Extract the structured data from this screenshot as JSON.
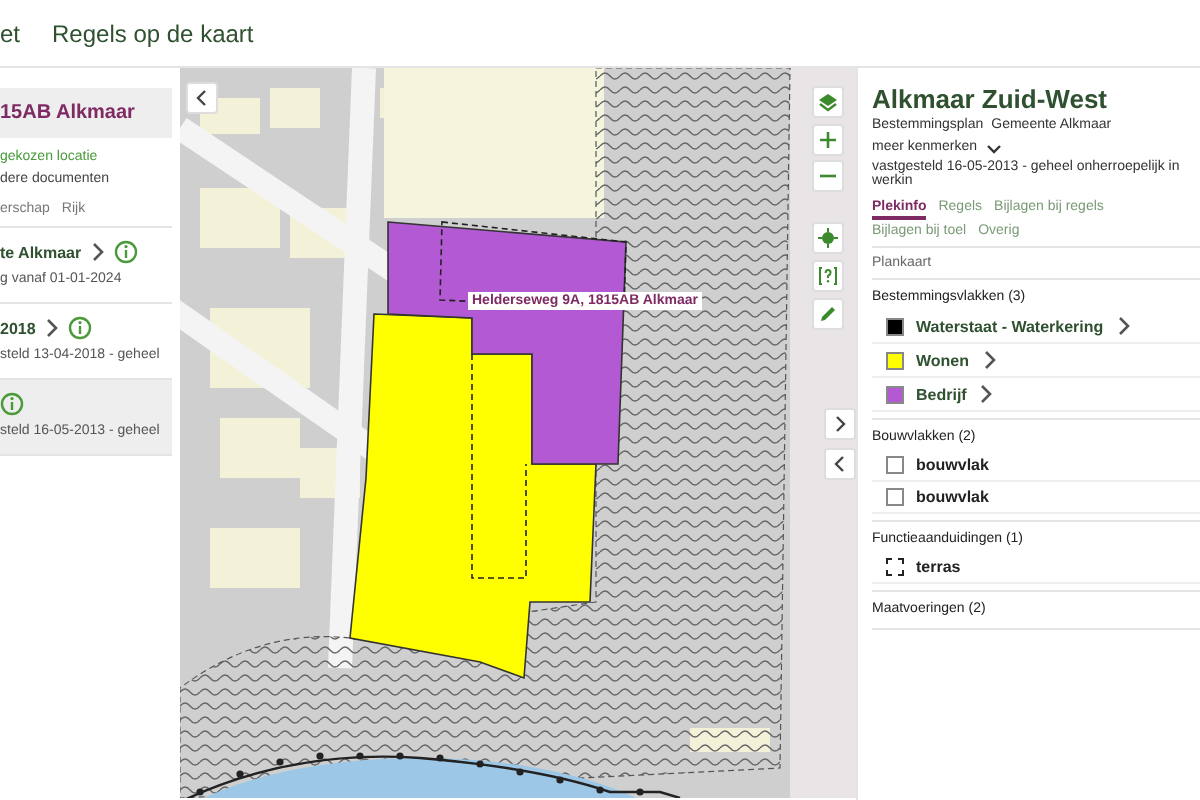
{
  "header": {
    "nav": [
      {
        "label": "et"
      },
      {
        "label": "Regels op de kaart"
      }
    ]
  },
  "left_panel": {
    "address": "15AB Alkmaar",
    "location_link": "gekozen locatie",
    "documents_text": "dere documenten",
    "tabs": [
      {
        "label": "erschap",
        "selected": false
      },
      {
        "label": "Rijk",
        "selected": false
      }
    ],
    "plans": [
      {
        "title": "te Alkmaar",
        "expandable": true,
        "status": "g vanaf 01-01-2024",
        "selected": false
      },
      {
        "title": "2018",
        "expandable": true,
        "status": "steld 13-04-2018 - geheel",
        "selected": false
      },
      {
        "expandable": false,
        "status": "steld 16-05-2013 - geheel",
        "selected": true
      }
    ]
  },
  "map": {
    "address_label": "Helderseweg 9A, 1815AB Alkmaar"
  },
  "right_panel": {
    "title": "Alkmaar Zuid-West",
    "subtitle": [
      "Bestemmingsplan",
      "Gemeente Alkmaar"
    ],
    "more_link": "meer kenmerken",
    "status": "vastgesteld 16-05-2013 - geheel onherroepelijk in werkin",
    "tabs": [
      {
        "label": "Plekinfo",
        "selected": true
      },
      {
        "label": "Regels",
        "selected": false
      },
      {
        "label": "Bijlagen bij regels",
        "selected": false
      },
      {
        "label": "Bijlagen bij toel",
        "selected": false
      },
      {
        "label": "Overig",
        "selected": false
      }
    ],
    "section_title": "Plankaart",
    "groups": [
      {
        "title": "Bestemmingsvlakken (3)",
        "items": [
          {
            "label": "Waterstaat - Waterkering",
            "kind": "fill",
            "color": "#000000",
            "expandable": true
          },
          {
            "label": "Wonen",
            "kind": "fill",
            "color": "#ffff00",
            "expandable": true
          },
          {
            "label": "Bedrijf",
            "kind": "fill",
            "color": "#b259d3",
            "expandable": true
          }
        ]
      },
      {
        "title": "Bouwvlakken (2)",
        "items": [
          {
            "label": "bouwvlak",
            "kind": "outline",
            "expandable": false
          },
          {
            "label": "bouwvlak",
            "kind": "outline",
            "expandable": false
          }
        ]
      },
      {
        "title": "Functieaanduidingen (1)",
        "items": [
          {
            "label": "terras",
            "kind": "dashed",
            "expandable": false
          }
        ]
      },
      {
        "title": "Maatvoeringen (2)"
      }
    ]
  }
}
